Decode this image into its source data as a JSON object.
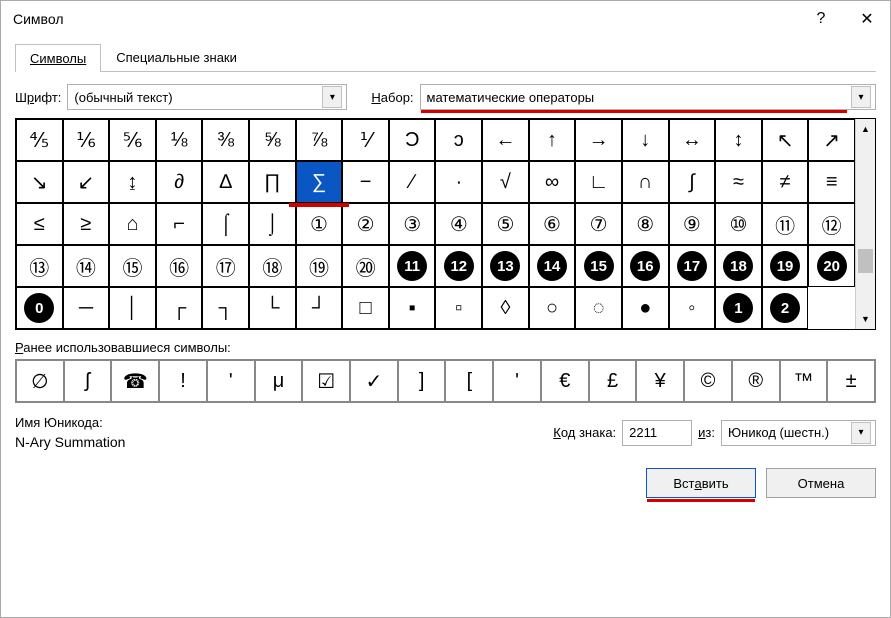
{
  "titlebar": {
    "title": "Символ",
    "help": "?",
    "close": "✕"
  },
  "tabs": {
    "symbols": "Символы",
    "special": "Специальные знаки"
  },
  "font": {
    "label_pre": "Ш",
    "label_u": "р",
    "label_post": "ифт:",
    "value": "(обычный текст)"
  },
  "subset": {
    "label_pre": "",
    "label_u": "Н",
    "label_post": "абор:",
    "value": "математические операторы"
  },
  "grid": [
    "⅘",
    "⅙",
    "⅚",
    "⅛",
    "⅜",
    "⅝",
    "⅞",
    "⅟",
    "Ɔ",
    "ɔ",
    "←",
    "↑",
    "→",
    "↓",
    "↔",
    "↕",
    "↖",
    "↗",
    "↘",
    "↙",
    "↨",
    "∂",
    "∆",
    "∏",
    "∑",
    "−",
    "∕",
    "∙",
    "√",
    "∞",
    "∟",
    "∩",
    "∫",
    "≈",
    "≠",
    "≡",
    "≤",
    "≥",
    "⌂",
    "⌐",
    "⌠",
    "⌡",
    "①",
    "②",
    "③",
    "④",
    "⑤",
    "⑥",
    "⑦",
    "⑧",
    "⑨",
    "⑩",
    "⑪",
    "⑫",
    "⑬",
    "⑭",
    "⑮",
    "⑯",
    "⑰",
    "⑱",
    "⑲",
    "⑳",
    "⓪",
    "─",
    "│",
    "┌",
    "┐",
    "└",
    "┘",
    "├",
    "┤",
    "┬",
    "┴",
    "┼",
    "═",
    "║",
    "╒",
    "╓",
    "╔",
    "╕"
  ],
  "black_circled": {
    "64": "11",
    "65": "12",
    "66": "13",
    "67": "14",
    "68": "15",
    "69": "16",
    "70": "17",
    "71": "18",
    "72": "19",
    "73": "20",
    "74": "0",
    "94": "1",
    "95": "2"
  },
  "grid_override": {
    "48": "⑬",
    "49": "⑭",
    "50": "⑮",
    "51": "⑯",
    "52": "⑰",
    "53": "⑱",
    "54": "⑲",
    "55": "⑳",
    "76": "─",
    "77": "│",
    "78": "┌",
    "79": "┐",
    "80": "└",
    "81": "┘",
    "82": "□",
    "83": "▪",
    "84": "▫",
    "85": "◊",
    "86": "○",
    "87": "◌",
    "88": "●",
    "89": "◦"
  },
  "selected_index": 24,
  "recent_label_pre": "",
  "recent_label_u": "Р",
  "recent_label_post": "анее использовавшиеся символы:",
  "recent": [
    "∅",
    "ʃ",
    "☎",
    "!",
    "ʹ",
    "μ",
    "☑",
    "✓",
    "]",
    "[",
    "ʹ",
    "€",
    "£",
    "¥",
    "©",
    "®",
    "™",
    "±"
  ],
  "unicode_label": "Имя Юникода:",
  "unicode_name": "N-Ary Summation",
  "code": {
    "label_pre": "",
    "label_u": "К",
    "label_post": "од знака:",
    "value": "2211"
  },
  "from": {
    "label_pre": "",
    "label_u": "и",
    "label_post": "з:",
    "value": "Юникод (шестн.)"
  },
  "buttons": {
    "insert_pre": "Вст",
    "insert_u": "а",
    "insert_post": "вить",
    "cancel": "Отмена"
  }
}
